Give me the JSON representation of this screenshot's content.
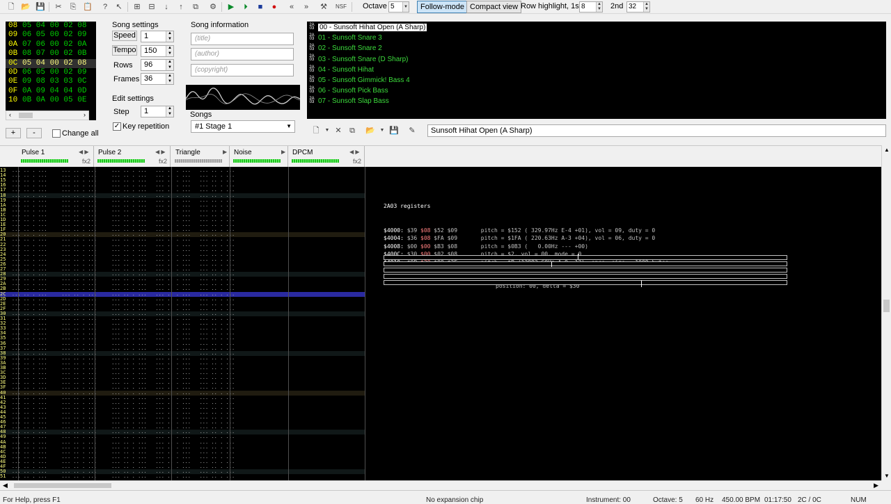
{
  "toolbar": {
    "octave_label": "Octave",
    "octave_value": "5",
    "follow_mode": "Follow-mode",
    "compact_view": "Compact view",
    "row_highlight_label": "Row highlight, 1st",
    "row_highlight_1st": "8",
    "second_label": "2nd",
    "row_highlight_2nd": "32"
  },
  "frames": {
    "rows": [
      {
        "idx": "08",
        "vals": "05 04 00 02 08"
      },
      {
        "idx": "09",
        "vals": "06 05 00 02 09"
      },
      {
        "idx": "0A",
        "vals": "07 06 00 02 0A"
      },
      {
        "idx": "0B",
        "vals": "08 07 00 02 0B"
      },
      {
        "idx": "0C",
        "vals": "05 04 00 02 08"
      },
      {
        "idx": "0D",
        "vals": "06 05 00 02 09"
      },
      {
        "idx": "0E",
        "vals": "09 08 03 03 0C"
      },
      {
        "idx": "0F",
        "vals": "0A 09 04 04 0D"
      },
      {
        "idx": "10",
        "vals": "0B 0A 00 05 0E"
      }
    ],
    "add": "+",
    "remove": "-",
    "change_all": "Change all"
  },
  "song_settings": {
    "title": "Song settings",
    "speed_label": "Speed",
    "speed": "1",
    "tempo_label": "Tempo",
    "tempo": "150",
    "rows_label": "Rows",
    "rows": "96",
    "frames_label": "Frames",
    "frames": "36"
  },
  "edit_settings": {
    "title": "Edit settings",
    "step_label": "Step",
    "step": "1",
    "key_repetition": "Key repetition",
    "key_repetition_checked": "✓"
  },
  "song_info": {
    "title": "Song information",
    "title_placeholder": "(title)",
    "author_placeholder": "(author)",
    "copyright_placeholder": "(copyright)"
  },
  "songs": {
    "label": "Songs",
    "selected": "#1 Stage 1"
  },
  "instruments": [
    "00 - Sunsoft Hihat Open (A Sharp)",
    "01 - Sunsoft Snare 3",
    "02 - Sunsoft Snare 2",
    "03 - Sunsoft Snare (D Sharp)",
    "04 - Sunsoft Hihat",
    "05 - Sunsoft Gimmick! Bass 4",
    "06 - Sunsoft Pick Bass",
    "07 - Sunsoft Slap Bass"
  ],
  "instrument_badge": "2A\n03",
  "instrument_name": "Sunsoft Hihat Open (A Sharp)",
  "channels": [
    {
      "name": "Pulse 1",
      "fx": "fx2"
    },
    {
      "name": "Pulse 2",
      "fx": "fx2"
    },
    {
      "name": "Triangle",
      "fx": ""
    },
    {
      "name": "Noise",
      "fx": ""
    },
    {
      "name": "DPCM",
      "fx": "fx2"
    }
  ],
  "registers": {
    "title": "2A03 registers",
    "lines": [
      {
        "addr": "$4000:",
        "v1": "$39",
        "v2": "$08",
        "v3": "$52",
        "v4": "$09",
        "info": "pitch = $152 ( 329.97Hz E-4 +01), vol = 09, duty = 0"
      },
      {
        "addr": "$4004:",
        "v1": "$36",
        "v2": "$08",
        "v3": "$FA",
        "v4": "$09",
        "info": "pitch = $1FA ( 220.63Hz A-3 +04), vol = 06, duty = 0"
      },
      {
        "addr": "$4008:",
        "v1": "$00",
        "v2": "$00",
        "v3": "$B3",
        "v4": "$08",
        "info": "pitch = $0B3 (   0.00Hz --- +00)"
      },
      {
        "addr": "$400C:",
        "v1": "$30",
        "v2": "$00",
        "v3": "$02",
        "v4": "$08",
        "info": "pitch = $2, vol = 00, mode = 0"
      },
      {
        "addr": "$4010:",
        "v1": "$0B",
        "v2": "$20",
        "v3": "$00",
        "v4": "$3F",
        "info": "pitch = $B (13982.60Hz A-9 -12), once, size = 1009 bytes"
      }
    ],
    "position": "position: 00, delta = $30"
  },
  "status": {
    "help": "For Help, press F1",
    "chip": "No expansion chip",
    "instrument": "Instrument: 00",
    "octave": "Octave: 5",
    "rate": "60 Hz",
    "bpm": "450.00 BPM",
    "time": "01:17:50",
    "pos": "2C / 0C",
    "num": "NUM"
  }
}
